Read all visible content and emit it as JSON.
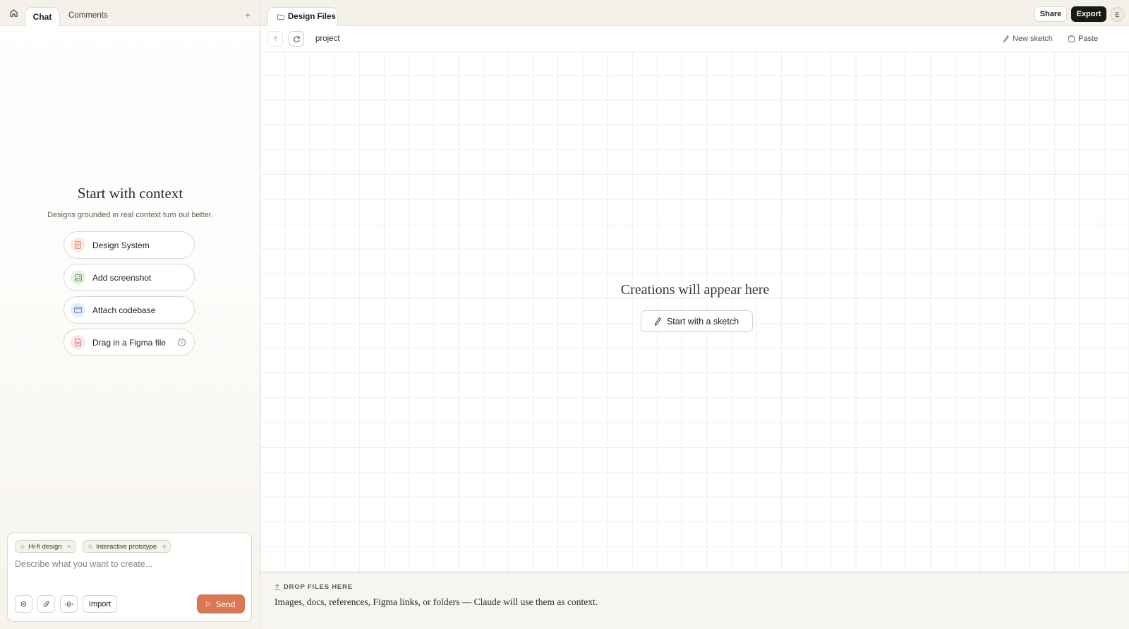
{
  "left_tabs": {
    "chat": "Chat",
    "comments": "Comments",
    "add": "+"
  },
  "context": {
    "title": "Start with context",
    "subtitle": "Designs grounded in real context turn out better.",
    "options": [
      {
        "label": "Design System",
        "icon": "document-icon",
        "color": "#e8866a"
      },
      {
        "label": "Add screenshot",
        "icon": "image-icon",
        "color": "#5f9a5a"
      },
      {
        "label": "Attach codebase",
        "icon": "code-window-icon",
        "color": "#5a8fc9"
      },
      {
        "label": "Drag in a Figma file",
        "icon": "figma-file-icon",
        "color": "#e26a78",
        "help": "?"
      }
    ]
  },
  "composer": {
    "chips": [
      {
        "label": "Hi-fi design",
        "remove": "×"
      },
      {
        "label": "Interactive prototype",
        "remove": "×"
      }
    ],
    "placeholder": "Describe what you want to create...",
    "import_label": "Import",
    "send_label": "Send",
    "accent": "#d97757"
  },
  "file_tab": {
    "label": "Design Files"
  },
  "header": {
    "share": "Share",
    "export": "Export",
    "avatar_initial": "E"
  },
  "toolbar": {
    "breadcrumb": "project",
    "new_sketch": "New sketch",
    "paste": "Paste"
  },
  "canvas": {
    "empty_title": "Creations will appear here",
    "sketch_button": "Start with a sketch"
  },
  "dropzone": {
    "heading": "DROP FILES HERE",
    "text": "Images, docs, references, Figma links, or folders — Claude will use them as context."
  }
}
